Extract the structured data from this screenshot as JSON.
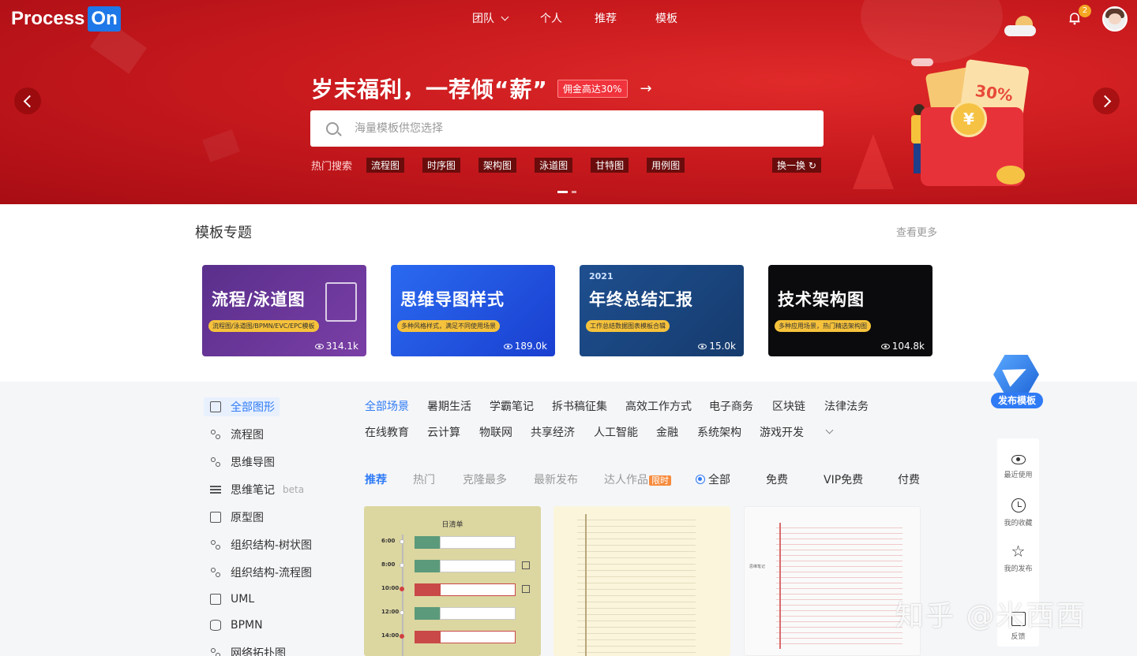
{
  "brand": {
    "logo_text": "Process",
    "logo_on": "On"
  },
  "nav": {
    "items": [
      "团队",
      "个人",
      "推荐",
      "模板"
    ]
  },
  "header": {
    "notification_count": "2"
  },
  "banner": {
    "headline": "岁末福利，一荐倾“薪”",
    "badge": "佣金高达30%",
    "arrow": "→",
    "envelope_top": "30%",
    "coin": "¥"
  },
  "search": {
    "placeholder": "海量模板供您选择"
  },
  "hot_search": {
    "label": "热门搜索",
    "tags": [
      "流程图",
      "时序图",
      "架构图",
      "泳道图",
      "甘特图",
      "用例图"
    ],
    "swap_label": "换一换"
  },
  "topics": {
    "title": "模板专题",
    "more": "查看更多",
    "cards": [
      {
        "title": "流程/泳道图",
        "sub": "流程图/泳道图/BPMN/EVC/EPC模板",
        "views": "314.1k",
        "year": ""
      },
      {
        "title": "思维导图样式",
        "sub": "多种风格样式，满足不同使用场景",
        "views": "189.0k",
        "year": ""
      },
      {
        "title": "年终总结汇报",
        "sub": "工作总结数据图表模板合辑",
        "views": "15.0k",
        "year": "2021"
      },
      {
        "title": "技术架构图",
        "sub": "多种应用场景，热门精选架构图",
        "views": "104.8k",
        "year": ""
      }
    ]
  },
  "sidebar": {
    "items": [
      {
        "label": "全部图形",
        "icon": "template-icon",
        "active": true
      },
      {
        "label": "流程图",
        "icon": "flowchart-icon"
      },
      {
        "label": "思维导图",
        "icon": "mindmap-icon"
      },
      {
        "label": "思维笔记",
        "icon": "list-icon",
        "badge": "beta"
      },
      {
        "label": "原型图",
        "icon": "prototype-icon"
      },
      {
        "label": "组织结构-树状图",
        "icon": "tree-icon"
      },
      {
        "label": "组织结构-流程图",
        "icon": "org-icon"
      },
      {
        "label": "UML",
        "icon": "uml-icon"
      },
      {
        "label": "BPMN",
        "icon": "bpmn-icon"
      },
      {
        "label": "网络拓扑图",
        "icon": "network-icon"
      }
    ]
  },
  "scenes": {
    "row1": [
      "全部场景",
      "暑期生活",
      "学霸笔记",
      "拆书稿征集",
      "高效工作方式",
      "电子商务",
      "区块链",
      "法律法务"
    ],
    "row2": [
      "在线教育",
      "云计算",
      "物联网",
      "共享经济",
      "人工智能",
      "金融",
      "系统架构",
      "游戏开发"
    ]
  },
  "sort": {
    "tabs": [
      "推荐",
      "热门",
      "克隆最多",
      "最新发布",
      "达人作品"
    ],
    "limited": "限时",
    "types": [
      "全部",
      "免费",
      "VIP免费",
      "付费"
    ]
  },
  "preview1": {
    "title": "日清单",
    "times": [
      "6:00",
      "8:00",
      "10:00",
      "12:00",
      "14:00"
    ]
  },
  "preview3": {
    "root": "思维笔记"
  },
  "publish": {
    "label": "发布模板"
  },
  "right_toolbar": {
    "items": [
      {
        "label": "最近使用",
        "icon": "eye-icon"
      },
      {
        "label": "我的收藏",
        "icon": "clock-icon"
      },
      {
        "label": "我的发布",
        "icon": "star-icon"
      },
      {
        "label": "反馈",
        "icon": "edit-icon"
      }
    ]
  },
  "watermark": "知乎 @米西西",
  "colors": {
    "accent": "#2f7bf5",
    "banner_red": "#c91a1e",
    "badge_orange": "#f5a623"
  }
}
